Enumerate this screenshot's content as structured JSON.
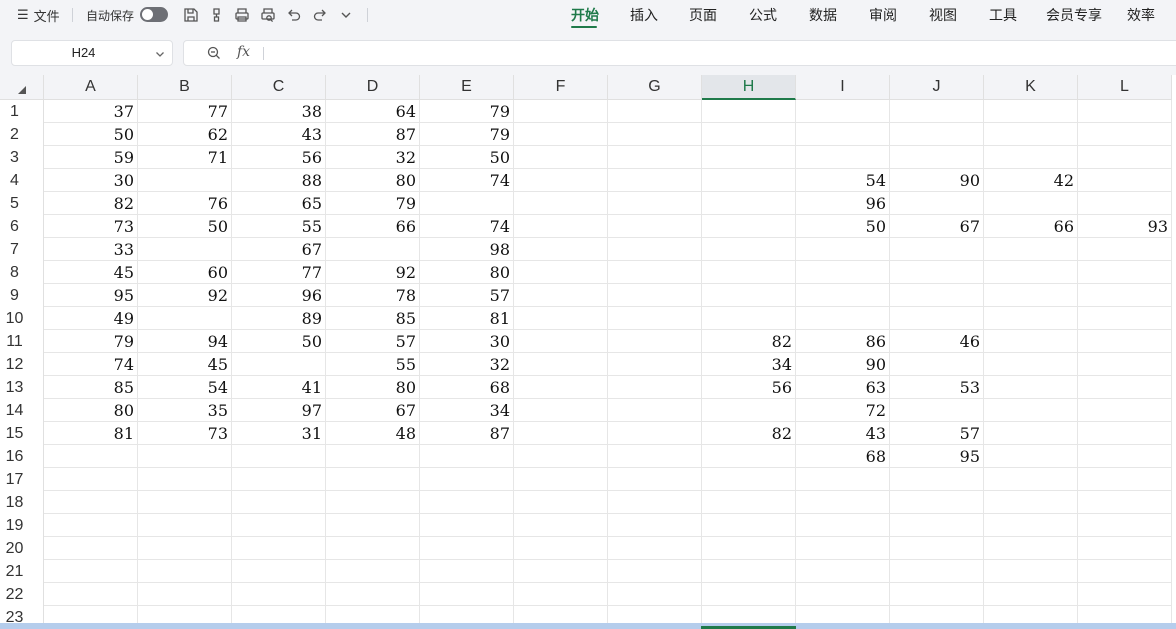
{
  "toolbar": {
    "file_label": "文件",
    "autosave_label": "自动保存",
    "icons": [
      "save-icon",
      "format-painter-icon",
      "print-icon",
      "print-preview-icon",
      "undo-icon",
      "redo-icon",
      "more-dropdown-icon"
    ],
    "menu_tabs": [
      "开始",
      "插入",
      "页面",
      "公式",
      "数据",
      "审阅",
      "视图",
      "工具",
      "会员专享",
      "效率"
    ],
    "active_tab": "开始",
    "accent_color": "#1f7a4a"
  },
  "formula_bar": {
    "cell_reference": "H24",
    "fx_label": "fx",
    "formula_value": ""
  },
  "sheet": {
    "columns": [
      "A",
      "B",
      "C",
      "D",
      "E",
      "F",
      "G",
      "H",
      "I",
      "J",
      "K",
      "L"
    ],
    "selected_column": "H",
    "rows": [
      "1",
      "2",
      "3",
      "4",
      "5",
      "6",
      "7",
      "8",
      "9",
      "10",
      "11",
      "12",
      "13",
      "14",
      "15",
      "16",
      "17",
      "18",
      "19",
      "20",
      "21",
      "22",
      "23"
    ],
    "cells": [
      [
        "37",
        "77",
        "38",
        "64",
        "79",
        "",
        "",
        "",
        "",
        "",
        "",
        ""
      ],
      [
        "50",
        "62",
        "43",
        "87",
        "79",
        "",
        "",
        "",
        "",
        "",
        "",
        ""
      ],
      [
        "59",
        "71",
        "56",
        "32",
        "50",
        "",
        "",
        "",
        "",
        "",
        "",
        ""
      ],
      [
        "30",
        "",
        "88",
        "80",
        "74",
        "",
        "",
        "",
        "54",
        "90",
        "42",
        ""
      ],
      [
        "82",
        "76",
        "65",
        "79",
        "",
        "",
        "",
        "",
        "96",
        "",
        "",
        ""
      ],
      [
        "73",
        "50",
        "55",
        "66",
        "74",
        "",
        "",
        "",
        "50",
        "67",
        "66",
        "93"
      ],
      [
        "33",
        "",
        "67",
        "",
        "98",
        "",
        "",
        "",
        "",
        "",
        "",
        ""
      ],
      [
        "45",
        "60",
        "77",
        "92",
        "80",
        "",
        "",
        "",
        "",
        "",
        "",
        ""
      ],
      [
        "95",
        "92",
        "96",
        "78",
        "57",
        "",
        "",
        "",
        "",
        "",
        "",
        ""
      ],
      [
        "49",
        "",
        "89",
        "85",
        "81",
        "",
        "",
        "",
        "",
        "",
        "",
        ""
      ],
      [
        "79",
        "94",
        "50",
        "57",
        "30",
        "",
        "",
        "82",
        "86",
        "46",
        "",
        ""
      ],
      [
        "74",
        "45",
        "",
        "55",
        "32",
        "",
        "",
        "34",
        "90",
        "",
        "",
        ""
      ],
      [
        "85",
        "54",
        "41",
        "80",
        "68",
        "",
        "",
        "56",
        "63",
        "53",
        "",
        ""
      ],
      [
        "80",
        "35",
        "97",
        "67",
        "34",
        "",
        "",
        "",
        "72",
        "",
        "",
        ""
      ],
      [
        "81",
        "73",
        "31",
        "48",
        "87",
        "",
        "",
        "82",
        "43",
        "57",
        "",
        ""
      ],
      [
        "",
        "",
        "",
        "",
        "",
        "",
        "",
        "",
        "68",
        "95",
        "",
        ""
      ],
      [
        "",
        "",
        "",
        "",
        "",
        "",
        "",
        "",
        "",
        "",
        "",
        ""
      ],
      [
        "",
        "",
        "",
        "",
        "",
        "",
        "",
        "",
        "",
        "",
        "",
        ""
      ],
      [
        "",
        "",
        "",
        "",
        "",
        "",
        "",
        "",
        "",
        "",
        "",
        ""
      ],
      [
        "",
        "",
        "",
        "",
        "",
        "",
        "",
        "",
        "",
        "",
        "",
        ""
      ],
      [
        "",
        "",
        "",
        "",
        "",
        "",
        "",
        "",
        "",
        "",
        "",
        ""
      ],
      [
        "",
        "",
        "",
        "",
        "",
        "",
        "",
        "",
        "",
        "",
        "",
        ""
      ],
      [
        "",
        "",
        "",
        "",
        "",
        "",
        "",
        "",
        "",
        "",
        "",
        ""
      ]
    ]
  }
}
